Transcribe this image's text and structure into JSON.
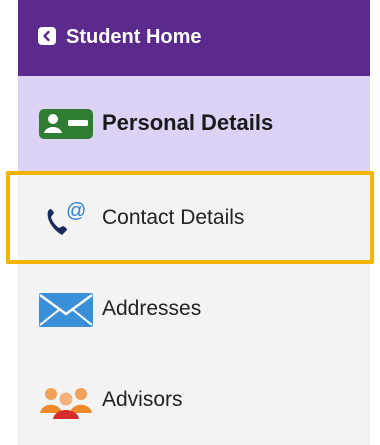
{
  "header": {
    "title": "Student Home",
    "back_icon": "chevron-left-icon",
    "background_color": "#5b2a8c"
  },
  "nav": {
    "items": [
      {
        "label": "Personal Details",
        "icon": "id-card-icon",
        "active": true
      },
      {
        "label": "Contact Details",
        "icon": "phone-at-icon",
        "highlighted": true
      },
      {
        "label": "Addresses",
        "icon": "envelope-icon"
      },
      {
        "label": "Advisors",
        "icon": "people-icon"
      }
    ],
    "active_background": "#dcd2f6",
    "highlight_color": "#f4b400"
  }
}
